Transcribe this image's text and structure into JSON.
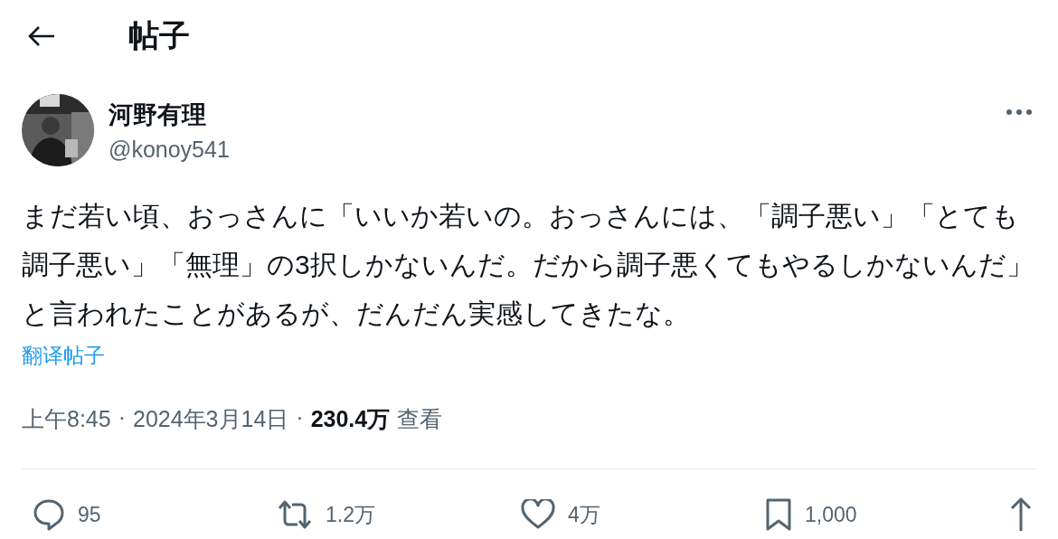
{
  "header": {
    "title": "帖子"
  },
  "post": {
    "author": {
      "name": "河野有理",
      "handle": "@konoy541"
    },
    "text": "まだ若い頃、おっさんに「いいか若いの。おっさんには、「調子悪い」「とても調子悪い」「無理」の3択しかないんだ。だから調子悪くてもやるしかないんだ」と言われたことがあるが、だんだん実感してきたな。",
    "translate_link": "翻译帖子",
    "meta": {
      "time": "上午8:45",
      "separator_1": "·",
      "date": "2024年3月14日",
      "separator_2": "·",
      "views": "230.4万",
      "views_label": "查看"
    },
    "actions": [
      {
        "kind": "reply",
        "count": "95"
      },
      {
        "kind": "repost",
        "count": "1.2万"
      },
      {
        "kind": "like",
        "count": "4万"
      },
      {
        "kind": "bookmark",
        "count": "1,000"
      },
      {
        "kind": "share"
      }
    ]
  }
}
